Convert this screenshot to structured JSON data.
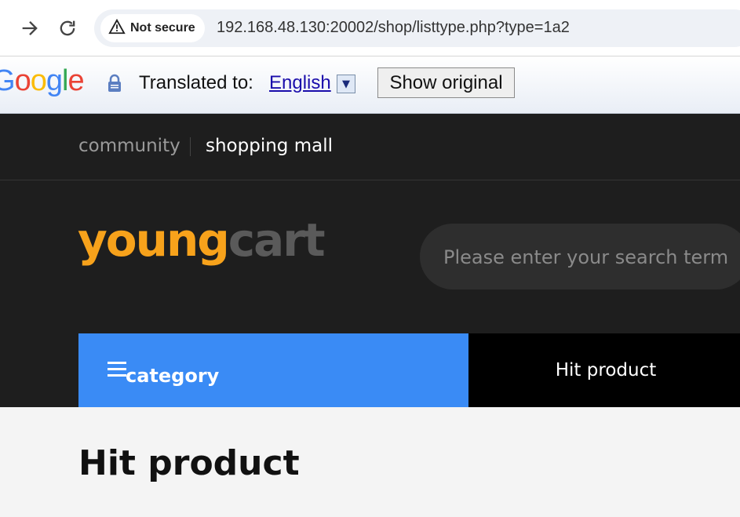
{
  "browser": {
    "security_label": "Not secure",
    "url": "192.168.48.130:20002/shop/listtype.php?type=1a2",
    "icons": [
      "forward-icon",
      "reload-icon",
      "warning-icon"
    ]
  },
  "translate": {
    "logo_text": "Google",
    "translated_to_label": "Translated to:",
    "language": "English",
    "show_original_label": "Show original"
  },
  "site": {
    "topnav": {
      "community": "community",
      "shopping_mall": "shopping mall"
    },
    "logo": {
      "part1": "young",
      "part2": "cart"
    },
    "search_placeholder": "Please enter your search term",
    "category_label": "category",
    "hit_product_label": "Hit product",
    "page_title": "Hit product",
    "colors": {
      "header_bg": "#1e1e1e",
      "accent_blue": "#3a8bf5",
      "logo_orange": "#f7a21b"
    }
  }
}
